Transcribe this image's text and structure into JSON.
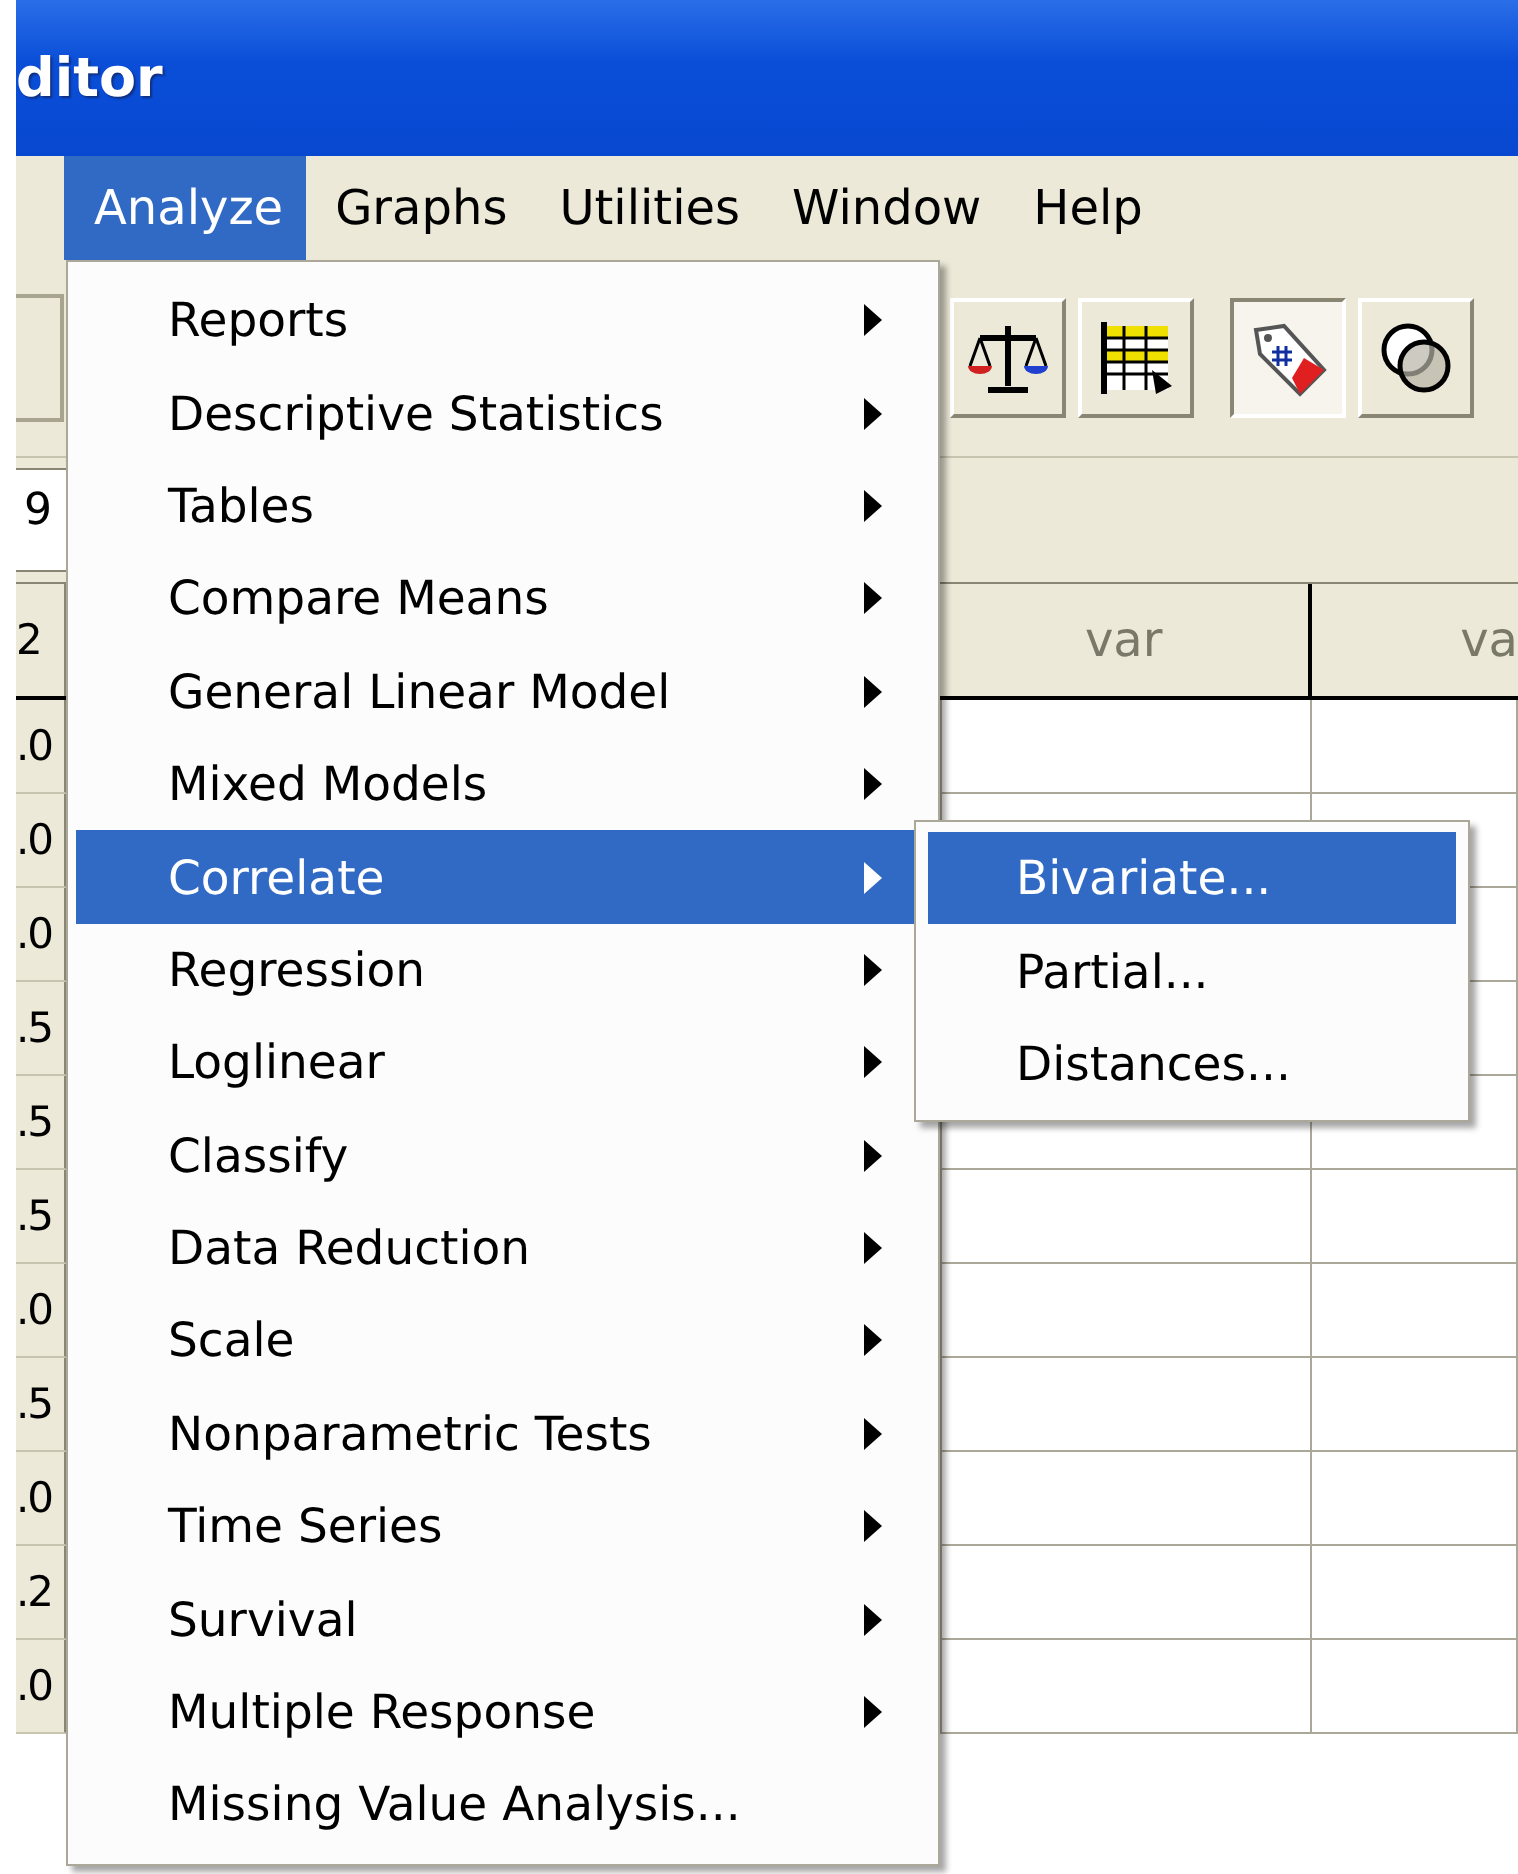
{
  "window": {
    "title": "ditor"
  },
  "menu_bar": [
    {
      "label": "Analyze",
      "selected": true
    },
    {
      "label": "Graphs",
      "selected": false
    },
    {
      "label": "Utilities",
      "selected": false
    },
    {
      "label": "Window",
      "selected": false
    },
    {
      "label": "Help",
      "selected": false
    }
  ],
  "toolbar": [
    {
      "kind": "scale",
      "pressed": false
    },
    {
      "kind": "table",
      "pressed": false
    },
    {
      "kind": "tag",
      "pressed": true
    },
    {
      "kind": "circles",
      "pressed": false
    }
  ],
  "cell_editor": {
    "value": "9"
  },
  "grid": {
    "corner": "2",
    "columns": [
      "var",
      "va"
    ],
    "row_values": [
      ".0",
      ".0",
      ".0",
      ".5",
      ".5",
      ".5",
      ".0",
      ".5",
      ".0",
      ".2",
      ".0"
    ]
  },
  "analyze_menu": [
    {
      "label": "Reports",
      "submenu": true,
      "selected": false
    },
    {
      "label": "Descriptive Statistics",
      "submenu": true,
      "selected": false
    },
    {
      "label": "Tables",
      "submenu": true,
      "selected": false
    },
    {
      "label": "Compare Means",
      "submenu": true,
      "selected": false
    },
    {
      "label": "General Linear Model",
      "submenu": true,
      "selected": false
    },
    {
      "label": "Mixed Models",
      "submenu": true,
      "selected": false
    },
    {
      "label": "Correlate",
      "submenu": true,
      "selected": true
    },
    {
      "label": "Regression",
      "submenu": true,
      "selected": false
    },
    {
      "label": "Loglinear",
      "submenu": true,
      "selected": false
    },
    {
      "label": "Classify",
      "submenu": true,
      "selected": false
    },
    {
      "label": "Data Reduction",
      "submenu": true,
      "selected": false
    },
    {
      "label": "Scale",
      "submenu": true,
      "selected": false
    },
    {
      "label": "Nonparametric Tests",
      "submenu": true,
      "selected": false
    },
    {
      "label": "Time Series",
      "submenu": true,
      "selected": false
    },
    {
      "label": "Survival",
      "submenu": true,
      "selected": false
    },
    {
      "label": "Multiple Response",
      "submenu": true,
      "selected": false
    },
    {
      "label": "Missing Value Analysis...",
      "submenu": false,
      "selected": false
    }
  ],
  "correlate_submenu": [
    {
      "label": "Bivariate...",
      "selected": true
    },
    {
      "label": "Partial...",
      "selected": false
    },
    {
      "label": "Distances...",
      "selected": false
    }
  ]
}
